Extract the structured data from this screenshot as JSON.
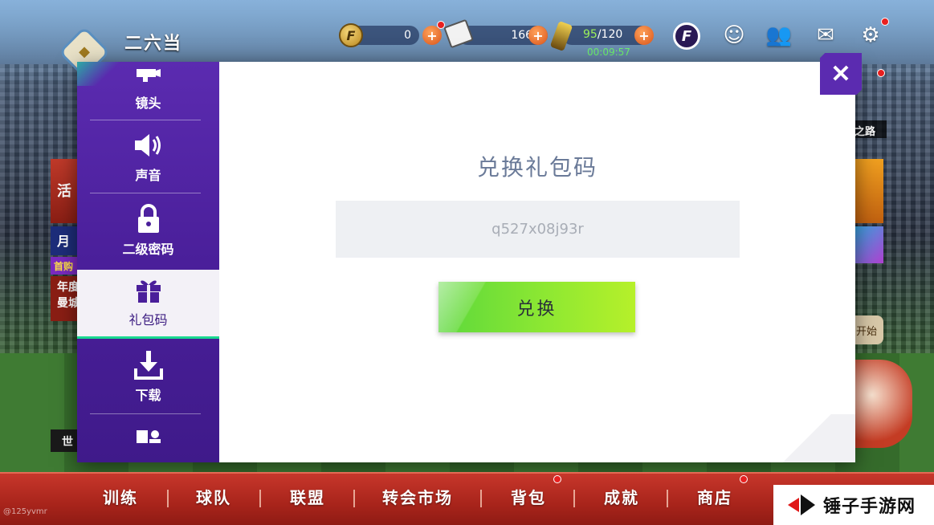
{
  "player": {
    "name": "二六当"
  },
  "resources": {
    "coins": "0",
    "tickets": "1660",
    "energy_current": "95",
    "energy_max": "/120",
    "energy_timer": "00:09:57",
    "coin_symbol": "F",
    "club_logo": "F"
  },
  "side_peeks": {
    "left": [
      "活",
      "月",
      "首购",
      "年度",
      "曼城",
      "世"
    ],
    "right_label": "之路",
    "right_start": "开始"
  },
  "settings_menu": {
    "items": [
      {
        "label": "镜头",
        "icon": "camera-icon"
      },
      {
        "label": "声音",
        "icon": "speaker-icon"
      },
      {
        "label": "二级密码",
        "icon": "lock-icon"
      },
      {
        "label": "礼包码",
        "icon": "gift-icon",
        "active": true
      },
      {
        "label": "下载",
        "icon": "download-icon"
      },
      {
        "label": "",
        "icon": "account-icon"
      }
    ]
  },
  "redeem": {
    "title": "兑换礼包码",
    "code_value": "q527x08j93r",
    "button_label": "兑换"
  },
  "close_label": "✕",
  "bottom_nav": {
    "items": [
      "训练",
      "球队",
      "联盟",
      "转会市场",
      "背包",
      "成就",
      "商店"
    ]
  },
  "watermark": {
    "text": "锤子手游网"
  },
  "corner_note": "@125yvmr",
  "colors": {
    "sidebar_purple": "#4a1f9a",
    "accent_green": "#8ee832",
    "nav_red": "#a8241b",
    "title_gray": "#6a7a98"
  }
}
